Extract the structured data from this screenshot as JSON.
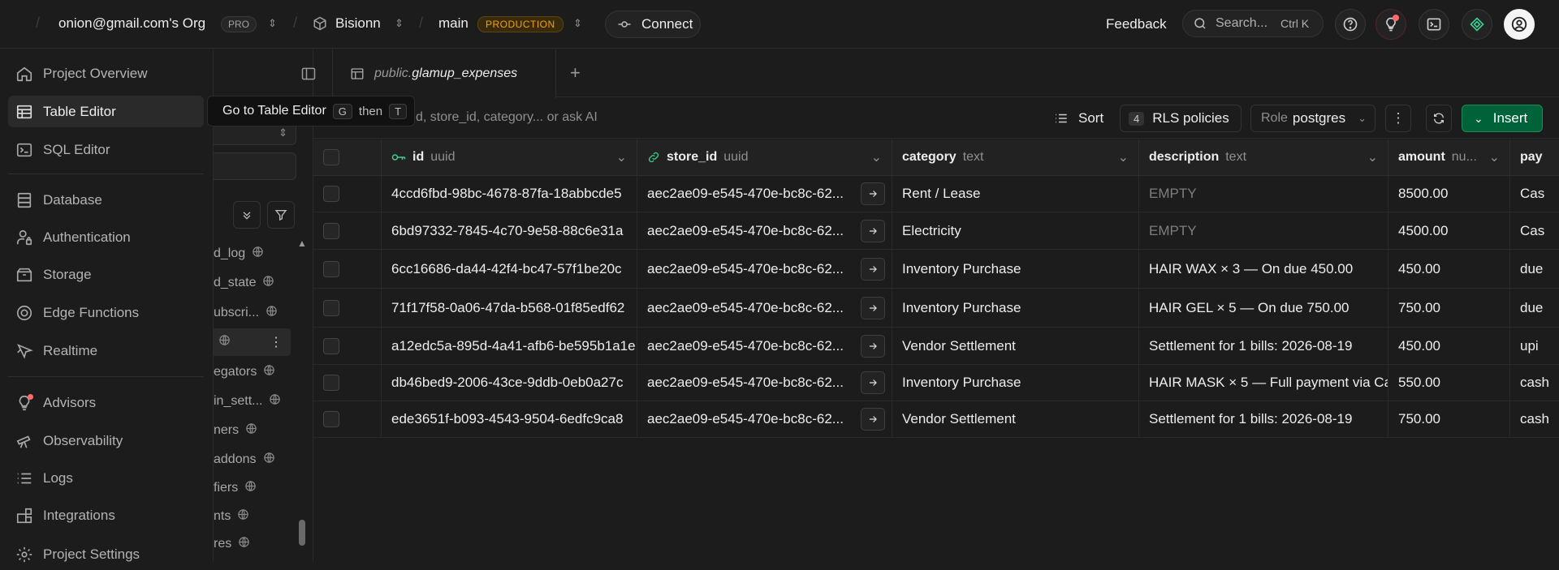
{
  "topbar": {
    "org": "onion@gmail.com's Org",
    "plan": "PRO",
    "project": "Bisionn",
    "branch": "main",
    "env": "PRODUCTION",
    "connect": "Connect",
    "feedback": "Feedback",
    "search_placeholder": "Search...",
    "search_shortcut": "Ctrl K"
  },
  "sidebar": {
    "items": [
      {
        "label": "Project Overview",
        "icon": "house-icon"
      },
      {
        "label": "Table Editor",
        "icon": "table-icon"
      },
      {
        "label": "SQL Editor",
        "icon": "terminal-icon"
      },
      {
        "label": "Database",
        "icon": "database-icon"
      },
      {
        "label": "Authentication",
        "icon": "user-icon"
      },
      {
        "label": "Storage",
        "icon": "archive-icon"
      },
      {
        "label": "Edge Functions",
        "icon": "edge-functions-icon"
      },
      {
        "label": "Realtime",
        "icon": "realtime-icon"
      },
      {
        "label": "Advisors",
        "icon": "lightbulb-icon"
      },
      {
        "label": "Observability",
        "icon": "telescope-icon"
      },
      {
        "label": "Logs",
        "icon": "list-icon"
      },
      {
        "label": "Integrations",
        "icon": "blocks-icon"
      },
      {
        "label": "Project Settings",
        "icon": "settings-icon"
      }
    ]
  },
  "tooltip": {
    "text": "Go to Table Editor",
    "key1": "G",
    "then": "then",
    "key2": "T"
  },
  "tables": [
    "d_log",
    "d_state",
    "ubscri...",
    "",
    "egators",
    "in_sett...",
    "ners",
    "addons",
    "fiers",
    "nts",
    "res"
  ],
  "tab": {
    "schema": "public.",
    "name": "glamup_expenses"
  },
  "toolbar": {
    "filter_placeholder": "d, store_id, category... or ask AI",
    "sort": "Sort",
    "rls_count": "4",
    "rls": "RLS policies",
    "role_label": "Role",
    "role": "postgres",
    "insert": "Insert"
  },
  "columns": [
    {
      "name": "id",
      "type": "uuid"
    },
    {
      "name": "store_id",
      "type": "uuid"
    },
    {
      "name": "category",
      "type": "text"
    },
    {
      "name": "description",
      "type": "text"
    },
    {
      "name": "amount",
      "type": "nu..."
    },
    {
      "name": "pay",
      "type": ""
    }
  ],
  "rows": [
    {
      "id": "4ccd6fbd-98bc-4678-87fa-18abbcde5",
      "store_id": "aec2ae09-e545-470e-bc8c-62...",
      "category": "Rent / Lease",
      "description": "EMPTY",
      "amount": "8500.00",
      "pay": "Cas"
    },
    {
      "id": "6bd97332-7845-4c70-9e58-88c6e31a",
      "store_id": "aec2ae09-e545-470e-bc8c-62...",
      "category": "Electricity",
      "description": "EMPTY",
      "amount": "4500.00",
      "pay": "Cas"
    },
    {
      "id": "6cc16686-da44-42f4-bc47-57f1be20c",
      "store_id": "aec2ae09-e545-470e-bc8c-62...",
      "category": "Inventory Purchase",
      "description": "HAIR WAX × 3 — On due 450.00",
      "amount": "450.00",
      "pay": "due"
    },
    {
      "id": "71f17f58-0a06-47da-b568-01f85edf62",
      "store_id": "aec2ae09-e545-470e-bc8c-62...",
      "category": "Inventory Purchase",
      "description": "HAIR GEL × 5 — On due 750.00",
      "amount": "750.00",
      "pay": "due"
    },
    {
      "id": "a12edc5a-895d-4a41-afb6-be595b1a1e",
      "store_id": "aec2ae09-e545-470e-bc8c-62...",
      "category": "Vendor Settlement",
      "description": "Settlement for 1 bills: 2026-08-19",
      "amount": "450.00",
      "pay": "upi"
    },
    {
      "id": "db46bed9-2006-43ce-9ddb-0eb0a27c",
      "store_id": "aec2ae09-e545-470e-bc8c-62...",
      "category": "Inventory Purchase",
      "description": "HAIR MASK × 5 — Full payment via Ca",
      "amount": "550.00",
      "pay": "cash"
    },
    {
      "id": "ede3651f-b093-4543-9504-6edfc9ca8",
      "store_id": "aec2ae09-e545-470e-bc8c-62...",
      "category": "Vendor Settlement",
      "description": "Settlement for 1 bills: 2026-08-19",
      "amount": "750.00",
      "pay": "cash"
    }
  ],
  "colors": {
    "accent": "#3ecf8e",
    "insert_bg": "#006239",
    "production": "#f1a10d",
    "notify": "#ff6b6b"
  }
}
